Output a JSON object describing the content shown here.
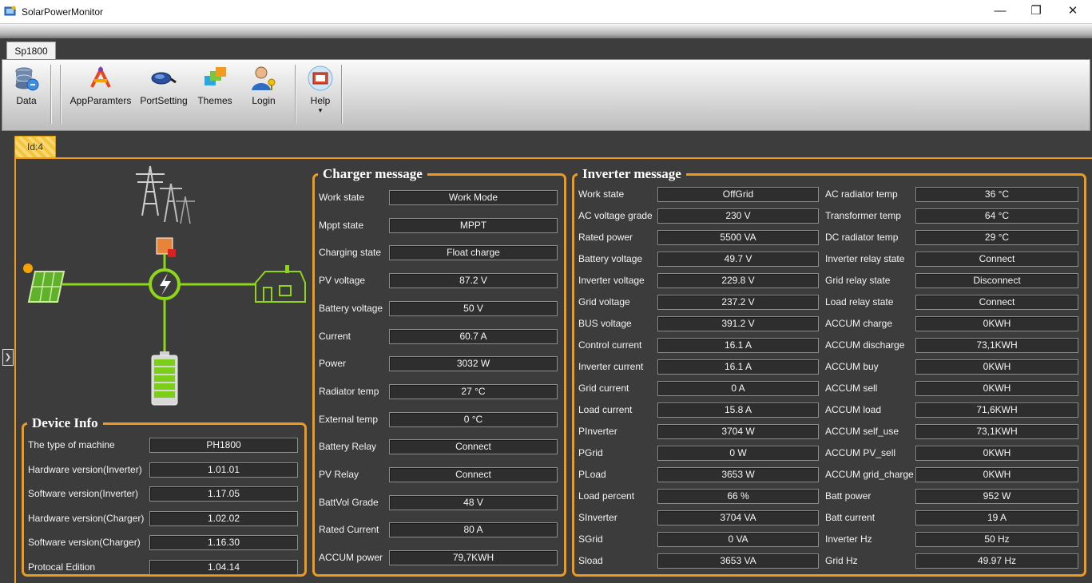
{
  "window": {
    "title": "SolarPowerMonitor",
    "min_glyph": "—",
    "max_glyph": "❐",
    "close_glyph": "✕"
  },
  "ribbon": {
    "tab_label": "Sp1800",
    "buttons": [
      {
        "label": "Data",
        "icon": "database-icon"
      },
      {
        "label": "AppParamters",
        "icon": "parameters-icon"
      },
      {
        "label": "PortSetting",
        "icon": "port-icon"
      },
      {
        "label": "Themes",
        "icon": "themes-icon"
      },
      {
        "label": "Login",
        "icon": "user-login-icon"
      },
      {
        "label": "Help",
        "icon": "help-book-icon",
        "dropdown": "▾"
      }
    ]
  },
  "doc_tab": {
    "label": "Id:4"
  },
  "device_info": {
    "title": "Device Info",
    "rows": [
      {
        "label": "The type of machine",
        "value": "PH1800"
      },
      {
        "label": "Hardware version(Inverter)",
        "value": "1.01.01"
      },
      {
        "label": "Software version(Inverter)",
        "value": "1.17.05"
      },
      {
        "label": "Hardware version(Charger)",
        "value": "1.02.02"
      },
      {
        "label": "Software version(Charger)",
        "value": "1.16.30"
      },
      {
        "label": "Protocal Edition",
        "value": "1.04.14"
      }
    ]
  },
  "charger": {
    "title": "Charger message",
    "rows": [
      {
        "label": "Work state",
        "value": "Work Mode"
      },
      {
        "label": "Mppt state",
        "value": "MPPT"
      },
      {
        "label": "Charging state",
        "value": "Float charge"
      },
      {
        "label": "PV voltage",
        "value": "87.2 V"
      },
      {
        "label": "Battery voltage",
        "value": "50 V"
      },
      {
        "label": "Current",
        "value": "60.7 A"
      },
      {
        "label": "Power",
        "value": "3032 W"
      },
      {
        "label": "Radiator temp",
        "value": "27 °C"
      },
      {
        "label": "External temp",
        "value": "0 °C"
      },
      {
        "label": "Battery Relay",
        "value": "Connect"
      },
      {
        "label": "PV Relay",
        "value": "Connect"
      },
      {
        "label": "BattVol Grade",
        "value": "48 V"
      },
      {
        "label": "Rated Current",
        "value": "80 A"
      },
      {
        "label": "ACCUM power",
        "value": "79,7KWH"
      }
    ]
  },
  "inverter": {
    "title": "Inverter message",
    "left": [
      {
        "label": "Work state",
        "value": "OffGrid"
      },
      {
        "label": "AC voltage grade",
        "value": "230 V"
      },
      {
        "label": "Rated power",
        "value": "5500 VA"
      },
      {
        "label": "Battery voltage",
        "value": "49.7 V"
      },
      {
        "label": "Inverter voltage",
        "value": "229.8 V"
      },
      {
        "label": "Grid voltage",
        "value": "237.2 V"
      },
      {
        "label": "BUS voltage",
        "value": "391.2 V"
      },
      {
        "label": "Control current",
        "value": "16.1 A"
      },
      {
        "label": "Inverter current",
        "value": "16.1 A"
      },
      {
        "label": "Grid current",
        "value": "0 A"
      },
      {
        "label": "Load current",
        "value": "15.8 A"
      },
      {
        "label": "PInverter",
        "value": "3704 W"
      },
      {
        "label": "PGrid",
        "value": "0 W"
      },
      {
        "label": "PLoad",
        "value": "3653 W"
      },
      {
        "label": "Load percent",
        "value": "66 %"
      },
      {
        "label": "SInverter",
        "value": "3704 VA"
      },
      {
        "label": "SGrid",
        "value": "0 VA"
      },
      {
        "label": "Sload",
        "value": "3653 VA"
      }
    ],
    "right": [
      {
        "label": "AC radiator temp",
        "value": "36 °C"
      },
      {
        "label": "Transformer temp",
        "value": "64 °C"
      },
      {
        "label": "DC radiator temp",
        "value": "29 °C"
      },
      {
        "label": "Inverter relay state",
        "value": "Connect"
      },
      {
        "label": "Grid relay state",
        "value": "Disconnect"
      },
      {
        "label": "Load relay state",
        "value": "Connect"
      },
      {
        "label": "ACCUM charge",
        "value": "0KWH"
      },
      {
        "label": "ACCUM discharge",
        "value": "73,1KWH"
      },
      {
        "label": "ACCUM buy",
        "value": "0KWH"
      },
      {
        "label": "ACCUM sell",
        "value": "0KWH"
      },
      {
        "label": "ACCUM load",
        "value": "71,6KWH"
      },
      {
        "label": "ACCUM self_use",
        "value": "73,1KWH"
      },
      {
        "label": "ACCUM PV_sell",
        "value": "0KWH"
      },
      {
        "label": "ACCUM grid_charge",
        "value": "0KWH"
      },
      {
        "label": "Batt power",
        "value": "952 W"
      },
      {
        "label": "Batt current",
        "value": "19 A"
      },
      {
        "label": "Inverter Hz",
        "value": "50 Hz"
      },
      {
        "label": "Grid Hz",
        "value": "49.97 Hz"
      }
    ]
  },
  "colors": {
    "accent": "#f09a1b",
    "flow_line": "#8ed61a",
    "panel_bg": "#3c3c3c"
  }
}
